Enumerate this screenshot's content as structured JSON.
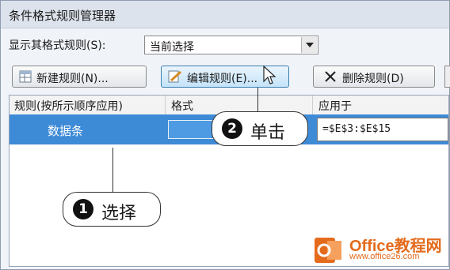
{
  "window": {
    "title": "条件格式规则管理器"
  },
  "show_rules": {
    "label": "显示其格式规则(S):",
    "value": "当前选择"
  },
  "toolbar": {
    "new_label": "新建规则(N)...",
    "edit_label": "编辑规则(E)...",
    "delete_label": "删除规则(D)"
  },
  "table": {
    "headers": [
      "规则(按所示顺序应用)",
      "格式",
      "应用于"
    ],
    "rows": [
      {
        "rule": "数据条",
        "applies_to": "=$E$3:$E$15"
      }
    ]
  },
  "callouts": [
    {
      "number": "1",
      "text": "选择"
    },
    {
      "number": "2",
      "text": "单击"
    }
  ],
  "watermark": {
    "title": "Office教程网",
    "url": "www.office26.com"
  },
  "colors": {
    "selection": "#3d8ad6",
    "databar": "#4e9ae3",
    "watermark": "#e46b1c"
  }
}
